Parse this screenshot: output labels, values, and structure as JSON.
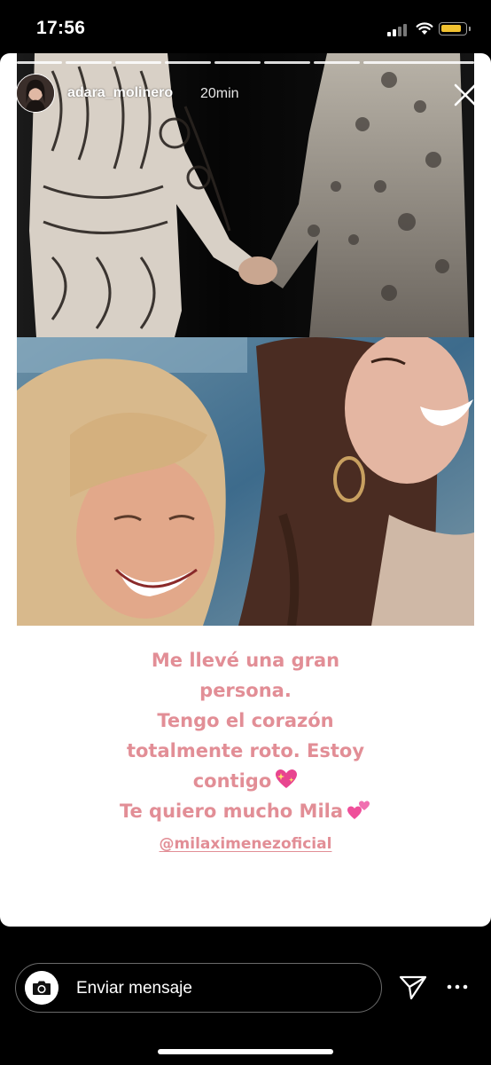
{
  "status_bar": {
    "time": "17:56",
    "battery_color": "#f2c230"
  },
  "story": {
    "username": "adara_molinero",
    "time_ago": "20min",
    "progress_segments": 8,
    "caption_lines": [
      "Me llevé una gran",
      "persona.",
      "Tengo el corazón",
      "totalmente roto. Estoy",
      "contigo",
      "Te quiero mucho Mila"
    ],
    "mention": "@milaximenezoficial",
    "caption_color": "#e28e96",
    "icons": {
      "close": "close-icon",
      "sparkling_heart": "sparkling-heart-icon",
      "two_hearts": "two-hearts-icon"
    }
  },
  "reply_bar": {
    "placeholder": "Enviar mensaje",
    "icons": {
      "camera": "camera-icon",
      "send": "send-icon",
      "more": "more-icon"
    }
  }
}
